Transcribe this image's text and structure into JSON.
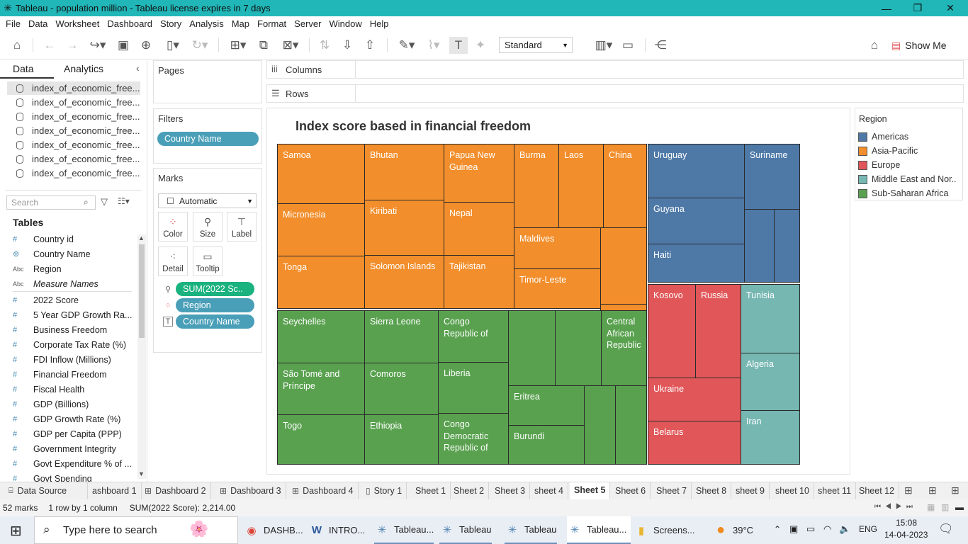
{
  "window": {
    "title": "Tableau - population million - Tableau license expires in 7 days",
    "controls": [
      "minimize",
      "restore",
      "close"
    ]
  },
  "menu": [
    "File",
    "Data",
    "Worksheet",
    "Dashboard",
    "Story",
    "Analysis",
    "Map",
    "Format",
    "Server",
    "Window",
    "Help"
  ],
  "toolbar": {
    "fit_select": "Standard",
    "show_me": "Show Me"
  },
  "data_pane": {
    "tab_data": "Data",
    "tab_analytics": "Analytics",
    "sources": [
      "index_of_economic_free...",
      "index_of_economic_free...",
      "index_of_economic_free...",
      "index_of_economic_free...",
      "index_of_economic_free...",
      "index_of_economic_free...",
      "index_of_economic_free..."
    ],
    "search_placeholder": "Search",
    "tables_header": "Tables",
    "fields": [
      {
        "icon": "#",
        "name": "Country id"
      },
      {
        "icon": "globe",
        "name": "Country Name"
      },
      {
        "icon": "Abc",
        "name": "Region"
      },
      {
        "icon": "Abc",
        "name": "Measure Names"
      },
      {
        "icon": "#",
        "name": "2022 Score"
      },
      {
        "icon": "#",
        "name": "5 Year GDP Growth Ra..."
      },
      {
        "icon": "#",
        "name": "Business Freedom"
      },
      {
        "icon": "#",
        "name": "Corporate Tax Rate (%)"
      },
      {
        "icon": "#",
        "name": "FDI Inflow (Millions)"
      },
      {
        "icon": "#",
        "name": "Financial Freedom"
      },
      {
        "icon": "#",
        "name": "Fiscal Health"
      },
      {
        "icon": "#",
        "name": "GDP (Billions)"
      },
      {
        "icon": "#",
        "name": "GDP Growth Rate (%)"
      },
      {
        "icon": "#",
        "name": "GDP per Capita (PPP)"
      },
      {
        "icon": "#",
        "name": "Government Integrity"
      },
      {
        "icon": "#",
        "name": "Govt Expenditure % of ..."
      },
      {
        "icon": "#",
        "name": "Govt Spending"
      }
    ]
  },
  "pages": {
    "title": "Pages"
  },
  "filters": {
    "title": "Filters",
    "pill": "Country Name"
  },
  "marks": {
    "title": "Marks",
    "type": "Automatic",
    "buttons": [
      "Color",
      "Size",
      "Label",
      "Detail",
      "Tooltip"
    ],
    "pills": [
      "SUM(2022 Sc..",
      "Region",
      "Country Name"
    ]
  },
  "shelves": {
    "columns": "Columns",
    "rows": "Rows"
  },
  "viz": {
    "title": "Index score based in financial freedom"
  },
  "chart_data": {
    "type": "treemap",
    "title": "Index score based in financial freedom",
    "size_measure": "SUM(2022 Score)",
    "color_by": "Region",
    "labels": {
      "asia": [
        "Samoa",
        "Micronesia",
        "Tonga",
        "Bhutan",
        "Kiribati",
        "Solomon Islands",
        "Papua New Guinea",
        "Nepal",
        "Tajikistan",
        "Burma",
        "Laos",
        "China",
        "Maldives",
        "Timor-Leste"
      ],
      "americas": [
        "Uruguay",
        "Suriname",
        "Guyana",
        "Haiti"
      ],
      "europe": [
        "Kosovo",
        "Russia",
        "Ukraine",
        "Belarus"
      ],
      "mena": [
        "Tunisia",
        "Algeria",
        "Iran"
      ],
      "ssa": [
        "Seychelles",
        "São Tomé and Príncipe",
        "Togo",
        "Sierra Leone",
        "Comoros",
        "Ethiopia",
        "Congo Republic of",
        "Liberia",
        "Congo Democratic Republic of",
        "Eritrea",
        "Burundi",
        "Central African Republic"
      ]
    }
  },
  "legend": {
    "title": "Region",
    "items": [
      {
        "name": "Americas",
        "color": "#4e79a7"
      },
      {
        "name": "Asia-Pacific",
        "color": "#f28e2b"
      },
      {
        "name": "Europe",
        "color": "#e15759"
      },
      {
        "name": "Middle East and Nor..",
        "color": "#76b7b2"
      },
      {
        "name": "Sub-Saharan Africa",
        "color": "#59a14f"
      }
    ]
  },
  "sheet_tabs": {
    "data_source": "Data Source",
    "tabs": [
      "ashboard 1",
      "Dashboard 2",
      "Dashboard 3",
      "Dashboard 4",
      "Story 1",
      "Sheet 1",
      "Sheet 2",
      "Sheet 3",
      "sheet 4",
      "Sheet 5",
      "Sheet 6",
      "Sheet 7",
      "Sheet 8",
      "sheet 9",
      "sheet 10",
      "sheet 11",
      "Sheet 12"
    ],
    "active": "Sheet 5"
  },
  "status": {
    "marks": "52 marks",
    "rows_cols": "1 row by 1 column",
    "sum": "SUM(2022 Score): 2,214.00"
  },
  "taskbar": {
    "search_placeholder": "Type here to search",
    "apps": [
      "DASHB...",
      "INTRO...",
      "Tableau...",
      "Tableau",
      "Tableau",
      "Tableau...",
      "Screens..."
    ],
    "weather": "39°C",
    "lang": "ENG",
    "time": "15:08",
    "date": "14-04-2023"
  }
}
